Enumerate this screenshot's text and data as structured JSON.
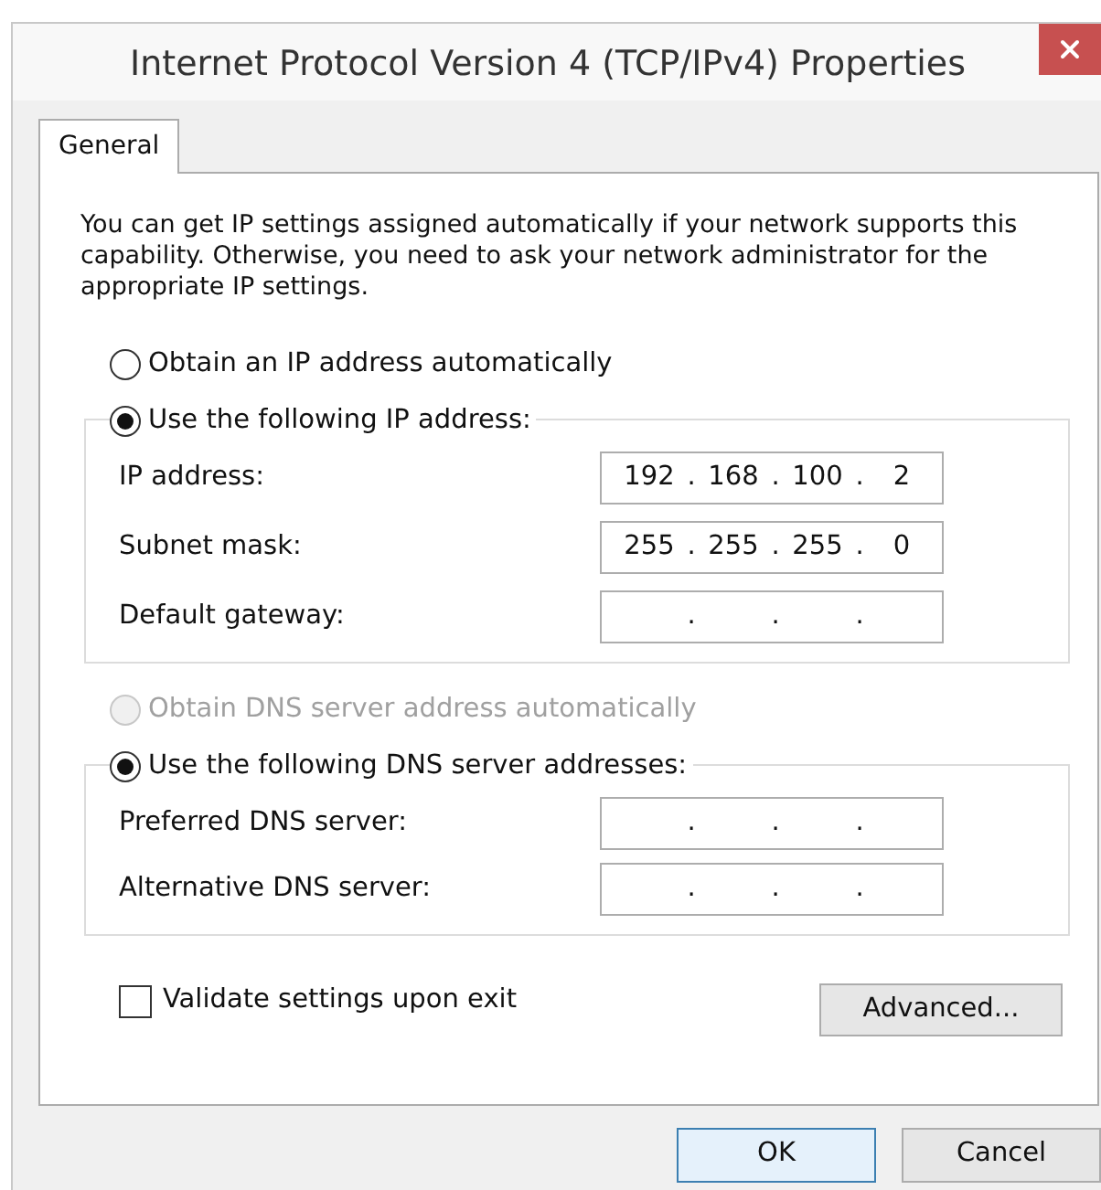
{
  "window": {
    "title": "Internet Protocol Version 4 (TCP/IPv4) Properties"
  },
  "tabs": [
    {
      "label": "General",
      "selected": true
    }
  ],
  "description": "You can get IP settings assigned automatically if your network supports this capability. Otherwise, you need to ask your network administrator for the appropriate IP settings.",
  "ip_separator": ".",
  "ip_section": {
    "auto_option": {
      "label": "Obtain an IP address automatically",
      "selected": false,
      "disabled": false
    },
    "manual_option": {
      "label": "Use the following IP address:",
      "selected": true,
      "disabled": false
    },
    "fields": [
      {
        "label": "IP address:",
        "octets": [
          "192",
          "168",
          "100",
          "2"
        ]
      },
      {
        "label": "Subnet mask:",
        "octets": [
          "255",
          "255",
          "255",
          "0"
        ]
      },
      {
        "label": "Default gateway:"
      }
    ]
  },
  "dns_section": {
    "auto_option": {
      "label": "Obtain DNS server address automatically",
      "selected": false,
      "disabled": true
    },
    "manual_option": {
      "label": "Use the following DNS server addresses:",
      "selected": true,
      "disabled": false
    },
    "fields": [
      {
        "label": "Preferred DNS server:"
      },
      {
        "label": "Alternative DNS server:"
      }
    ]
  },
  "validate_checkbox": {
    "label": "Validate settings upon exit",
    "checked": false
  },
  "advanced_button": "Advanced...",
  "buttons": [
    {
      "label": "OK",
      "default": true
    },
    {
      "label": "Cancel",
      "default": false
    }
  ]
}
